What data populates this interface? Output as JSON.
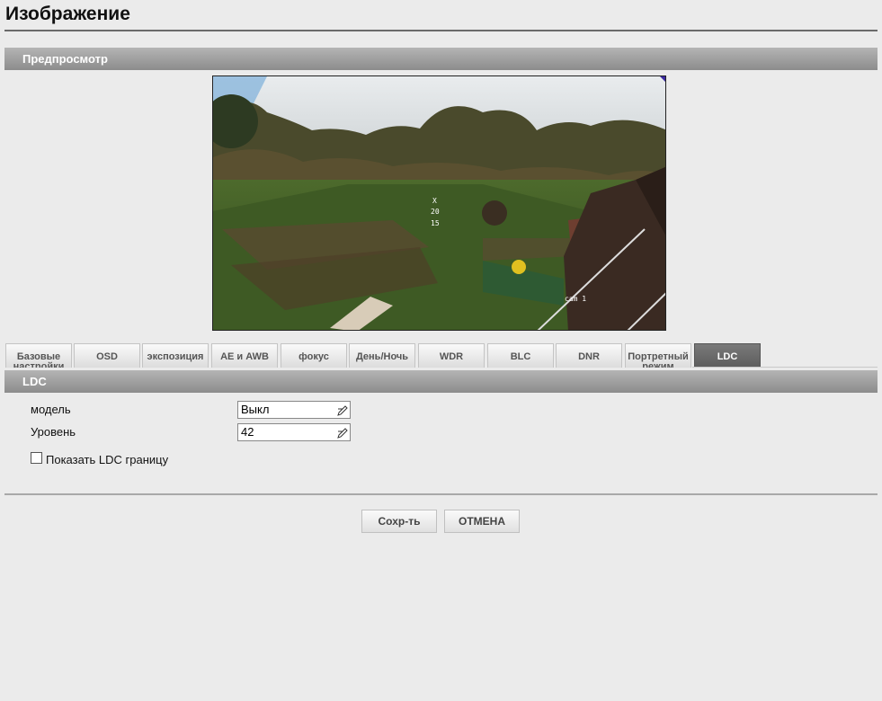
{
  "page": {
    "title": "Изображение"
  },
  "preview": {
    "header": "Предпросмотр",
    "osd_lines": [
      "X",
      "20",
      "15"
    ],
    "cam_label": "cam 1"
  },
  "tabs": [
    {
      "label": "Базовые настройки",
      "active": false
    },
    {
      "label": "OSD",
      "active": false
    },
    {
      "label": "экспозиция",
      "active": false
    },
    {
      "label": "AE и AWB",
      "active": false
    },
    {
      "label": "фокус",
      "active": false
    },
    {
      "label": "День/Ночь",
      "active": false
    },
    {
      "label": "WDR",
      "active": false
    },
    {
      "label": "BLC",
      "active": false
    },
    {
      "label": "DNR",
      "active": false
    },
    {
      "label": "Портретный режим",
      "active": false
    },
    {
      "label": "LDC",
      "active": true
    }
  ],
  "ldc": {
    "header": "LDC",
    "model_label": "модель",
    "model_value": "Выкл",
    "level_label": "Уровень",
    "level_value": "42",
    "show_border_label": "Показать LDC границу",
    "show_border_checked": false
  },
  "buttons": {
    "save": "Сохр-ть",
    "cancel": "ОТМЕНА"
  },
  "icons": {
    "edit": "pencil-edit-icon"
  }
}
